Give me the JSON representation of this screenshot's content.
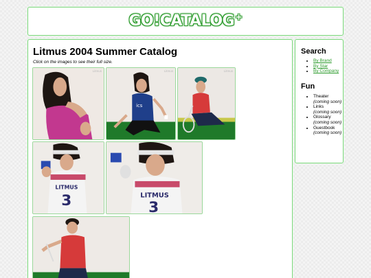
{
  "header": {
    "logo_text": "GO!CATALOG",
    "logo_mark": "+"
  },
  "main": {
    "title": "Litmus 2004 Summer Catalog",
    "hint": "Click on the images to see their full size.",
    "images": [
      {
        "watermark": "Litmus"
      },
      {
        "watermark": "Litmus"
      },
      {
        "watermark": "Litmus"
      },
      {
        "watermark": ""
      },
      {
        "watermark": ""
      },
      {
        "watermark": ""
      }
    ]
  },
  "sidebar": {
    "search_heading": "Search",
    "search_links": [
      "By Brand",
      "By Star",
      "By Company"
    ],
    "fun_heading": "Fun",
    "fun_items": [
      {
        "label": "Theater",
        "note": "(coming soon)"
      },
      {
        "label": "Links",
        "note": "(coming soon)"
      },
      {
        "label": "Glossary",
        "note": "(coming soon)"
      },
      {
        "label": "Guestbook",
        "note": "(coming soon)"
      }
    ]
  },
  "colors": {
    "accent": "#2a9a2a",
    "border": "#7fd67f"
  }
}
